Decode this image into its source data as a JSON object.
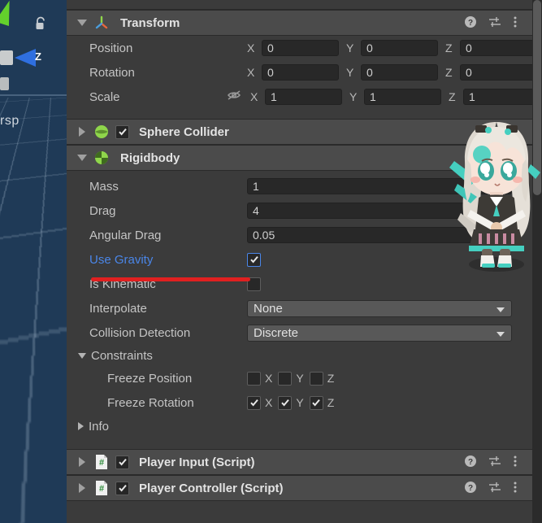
{
  "scene_view": {
    "axis_label_z": "Z",
    "overlay_text": "rsp",
    "lock_icon": "lock-icon",
    "gizmo_z_icon": "gizmo-cone-z-icon",
    "gizmo_y_icon": "gizmo-cone-y-icon"
  },
  "inspector": {
    "components": [
      {
        "name": "Transform",
        "icon": "transform-axis-icon",
        "expanded": true,
        "has_enable_checkbox": false,
        "actions": [
          "help-icon",
          "preset-icon",
          "more-menu-icon"
        ],
        "rows": [
          {
            "label": "Position",
            "axes": [
              "X",
              "Y",
              "Z"
            ],
            "values": [
              "0",
              "0",
              "0"
            ]
          },
          {
            "label": "Rotation",
            "axes": [
              "X",
              "Y",
              "Z"
            ],
            "values": [
              "0",
              "0",
              "0"
            ]
          },
          {
            "label": "Scale",
            "axes": [
              "X",
              "Y",
              "Z"
            ],
            "values": [
              "1",
              "1",
              "1"
            ],
            "lock_icon": "eye-off-icon"
          }
        ]
      },
      {
        "name": "Sphere Collider",
        "icon": "sphere-collider-icon",
        "expanded": false,
        "has_enable_checkbox": true,
        "enabled": true,
        "actions": [
          "help-icon"
        ]
      },
      {
        "name": "Rigidbody",
        "icon": "rigidbody-icon",
        "expanded": true,
        "has_enable_checkbox": false
      },
      {
        "name": "Player Input (Script)",
        "icon": "script-icon",
        "expanded": false,
        "has_enable_checkbox": true,
        "enabled": true,
        "actions": [
          "help-icon",
          "preset-icon",
          "more-menu-icon"
        ]
      },
      {
        "name": "Player Controller (Script)",
        "icon": "script-icon",
        "expanded": false,
        "has_enable_checkbox": true,
        "enabled": true,
        "actions": [
          "help-icon",
          "preset-icon",
          "more-menu-icon"
        ]
      }
    ],
    "rigidbody": {
      "mass_label": "Mass",
      "mass_value": "1",
      "drag_label": "Drag",
      "drag_value": "4",
      "angular_drag_label": "Angular Drag",
      "angular_drag_value": "0.05",
      "use_gravity_label": "Use Gravity",
      "use_gravity_checked": true,
      "is_kinematic_label": "Is Kinematic",
      "is_kinematic_checked": false,
      "interpolate_label": "Interpolate",
      "interpolate_value": "None",
      "collision_detection_label": "Collision Detection",
      "collision_detection_value": "Discrete",
      "constraints_label": "Constraints",
      "freeze_position_label": "Freeze Position",
      "freeze_position": {
        "x": false,
        "y": false,
        "z": false
      },
      "freeze_rotation_label": "Freeze Rotation",
      "freeze_rotation": {
        "x": true,
        "y": true,
        "z": true
      },
      "axis_x": "X",
      "axis_y": "Y",
      "axis_z": "Z",
      "info_label": "Info"
    }
  },
  "annotation": {
    "color": "#e02020",
    "target": "Use Gravity"
  },
  "colors": {
    "panel_bg": "#3b3b3b",
    "header_bg": "#4b4b4b",
    "field_bg": "#282828",
    "dropdown_bg": "#585858",
    "text": "#c4c4c4",
    "highlight_blue": "#4a86e8",
    "unity_green": "#8fd64b",
    "scene_bg": "#1f3a57"
  }
}
